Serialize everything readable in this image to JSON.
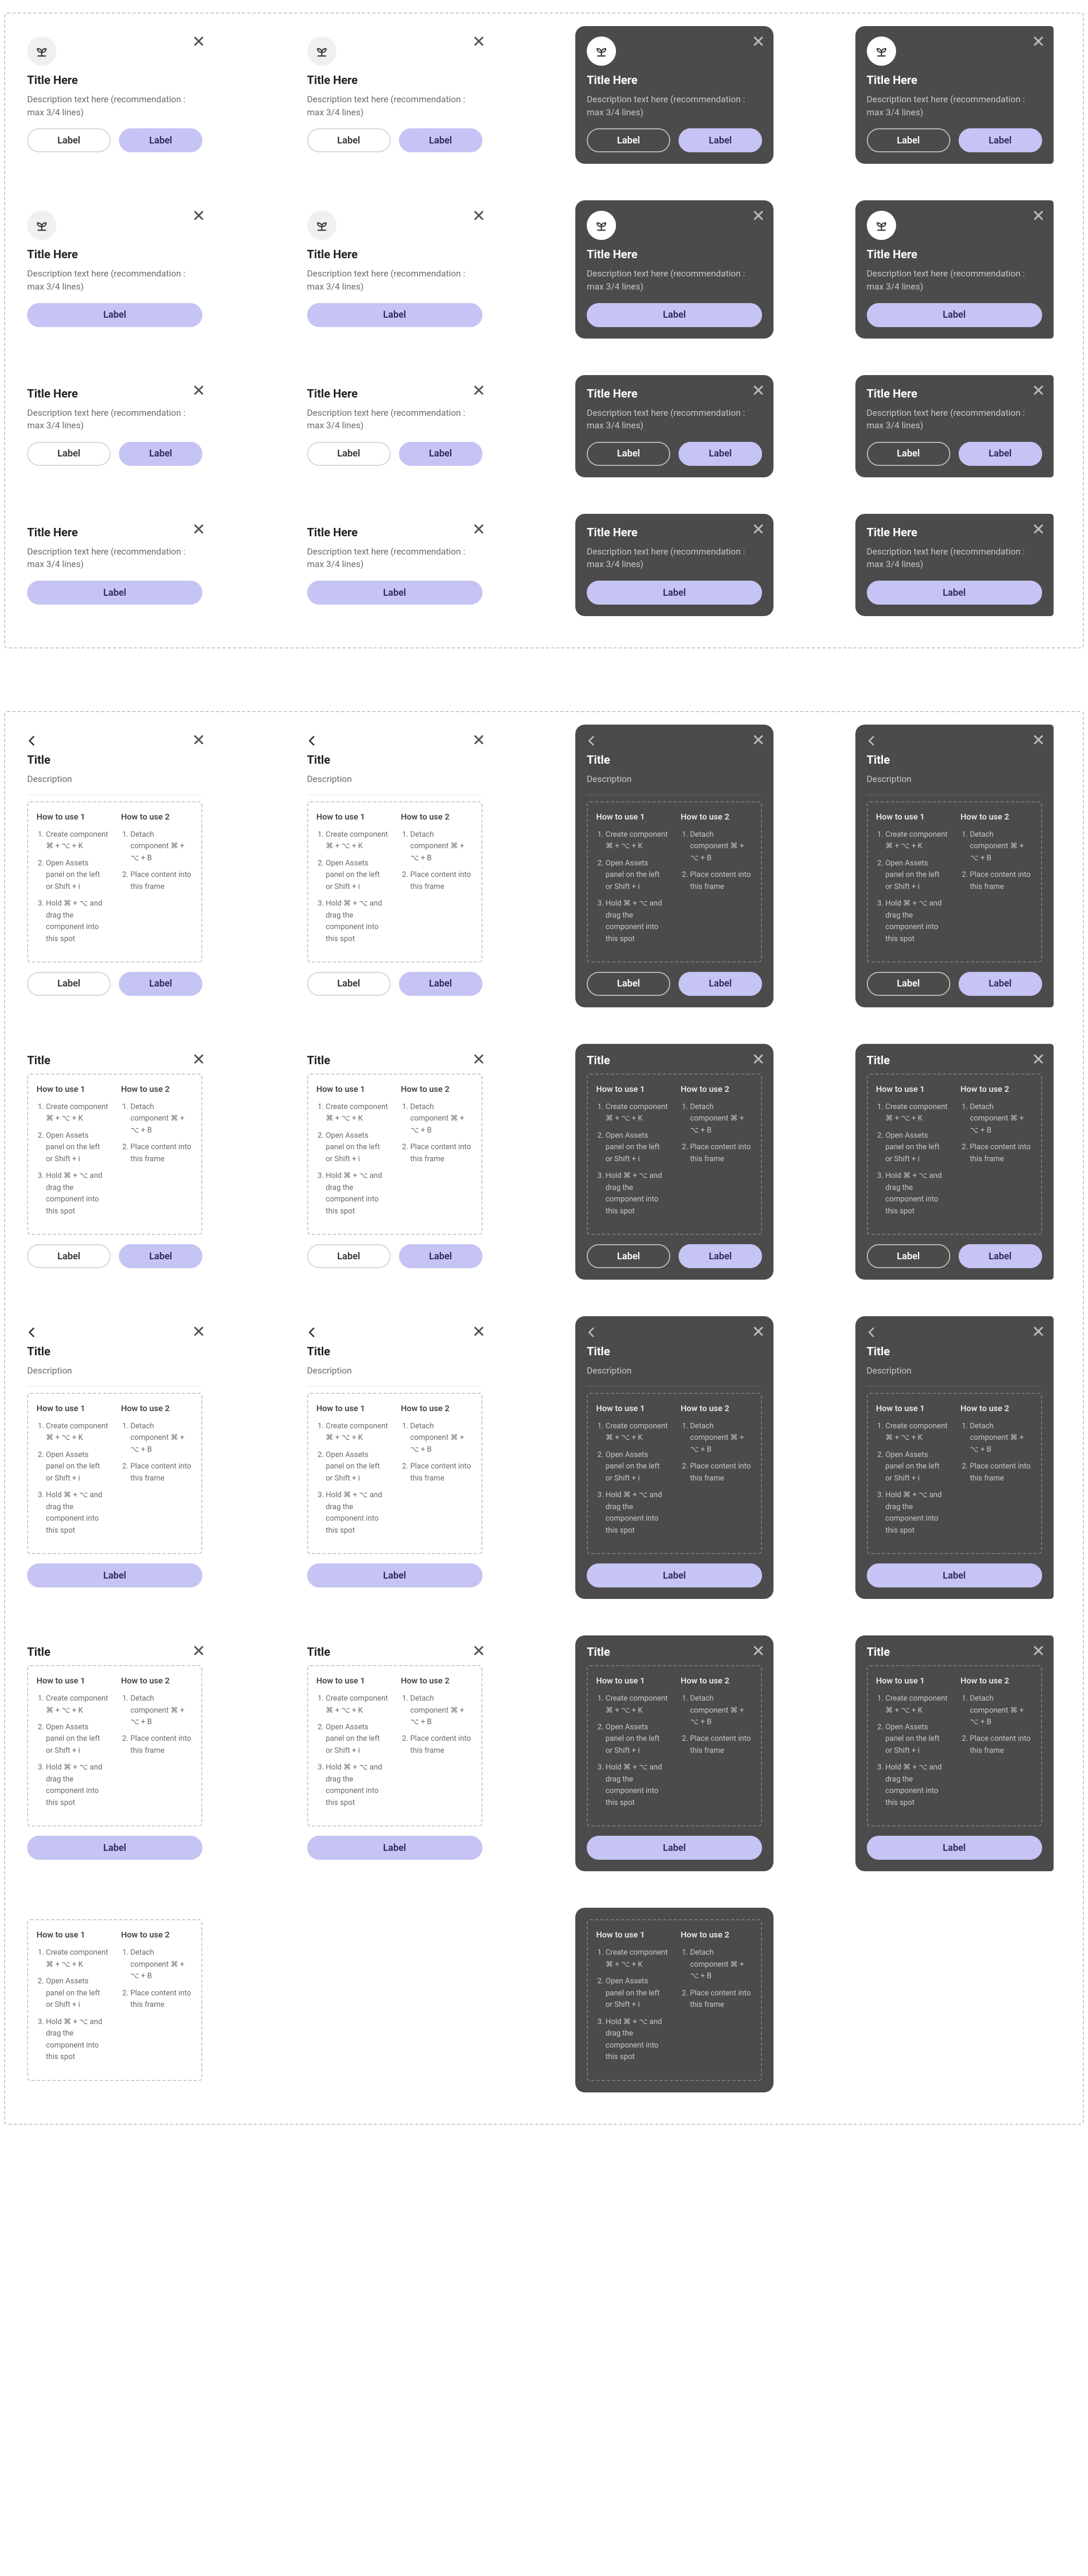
{
  "promo": {
    "title": "Title Here",
    "desc": "Description text here (recommendation : max 3/4 lines)",
    "secondary_label": "Label",
    "primary_label": "Label"
  },
  "detail": {
    "title": "Title",
    "desc": "Description",
    "secondary_label": "Label",
    "primary_label": "Label",
    "howto": {
      "col1_title": "How to use 1",
      "col2_title": "How to use 2",
      "col1_items": [
        "Create component ⌘ + ⌥ + K",
        "Open Assets panel on the left or Shift + i",
        "Hold ⌘ + ⌥ and drag the component into this spot"
      ],
      "col2_items": [
        "Detach component ⌘ + ⌥ + B",
        "Place content into this frame"
      ]
    }
  },
  "icons": {
    "close": "close-icon",
    "back": "chevron-left-icon",
    "hero": "sprout-icon"
  },
  "colors": {
    "accent": "#c6c4f5",
    "dark_bg": "#4b4b4b"
  }
}
